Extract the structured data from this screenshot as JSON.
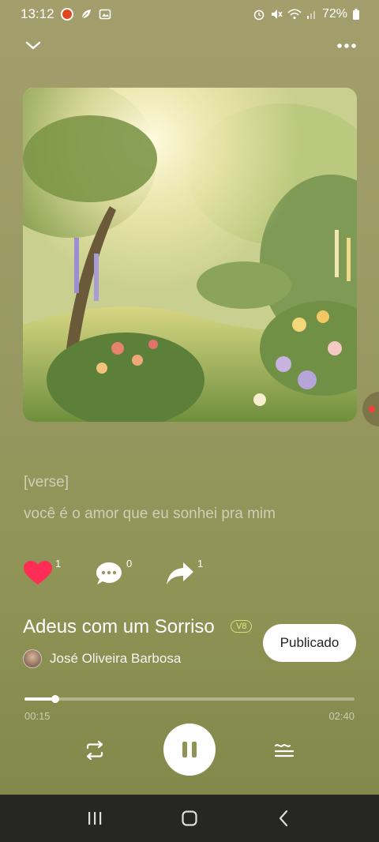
{
  "status_bar": {
    "time": "13:12",
    "battery": "72%",
    "icons": [
      "app-notification-icon",
      "leaf-icon",
      "gallery-icon",
      "alarm-icon",
      "mute-icon",
      "wifi-icon",
      "signal-icon",
      "battery-icon"
    ]
  },
  "top_bar": {
    "collapse_icon": "chevron-down-icon",
    "more_icon": "more-horizontal-icon"
  },
  "lyrics": {
    "section": "[verse]",
    "line": "você é o amor que eu sonhei pra mim"
  },
  "actions": {
    "like_count": "1",
    "comment_count": "0",
    "share_count": "1",
    "like_color": "#ff2d55"
  },
  "song": {
    "title": "Adeus com um Sorriso",
    "version": "V8",
    "artist": "José Oliveira Barbosa",
    "publish_label": "Publicado"
  },
  "player": {
    "current_time": "00:15",
    "total_time": "02:40",
    "progress": 0.094,
    "state": "playing"
  },
  "nav_bar": {
    "icons": [
      "recent-apps-icon",
      "home-icon",
      "back-icon"
    ]
  }
}
